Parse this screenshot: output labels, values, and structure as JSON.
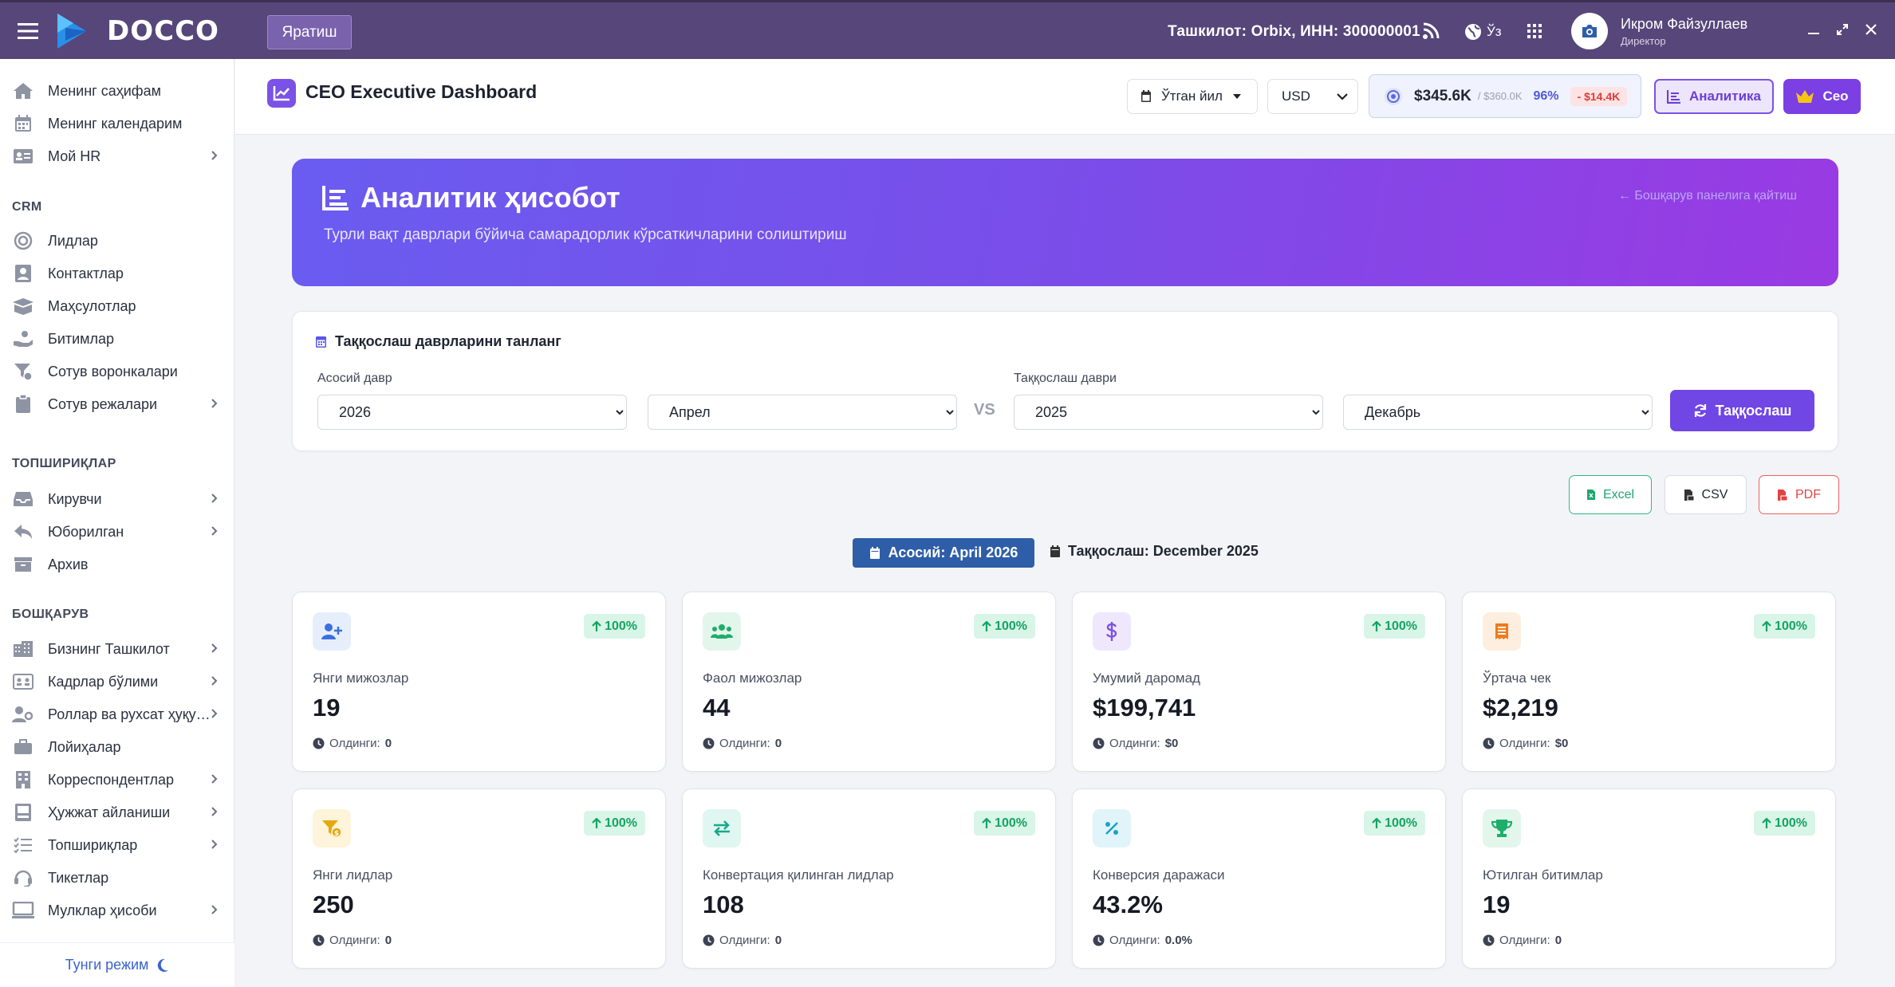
{
  "app": {
    "brand": "DOCCO",
    "create_label": "Яратиш"
  },
  "topbar": {
    "org": "Ташкилот: Orbix,  ИНН: 300000001",
    "lang": "Ўз",
    "user_name": "Икром Файзуллаев",
    "user_role": "Директор"
  },
  "sidebar": {
    "top_items": [
      {
        "label": "Менинг саҳифам",
        "icon": "home-icon"
      },
      {
        "label": "Менинг календарим",
        "icon": "calendar-icon"
      },
      {
        "label": "Мой HR",
        "icon": "id-card-icon"
      }
    ],
    "crm_title": "CRM",
    "crm_items": [
      {
        "label": "Лидлар",
        "icon": "target-icon"
      },
      {
        "label": "Контактлар",
        "icon": "contact-icon"
      },
      {
        "label": "Маҳсулотлар",
        "icon": "boxes-icon"
      },
      {
        "label": "Битимлар",
        "icon": "hand-coin-icon"
      },
      {
        "label": "Сотув воронкалари",
        "icon": "funnel-icon"
      },
      {
        "label": "Сотув режалари",
        "icon": "clipboard-icon"
      }
    ],
    "tasks_title": "ТОПШИРИҚЛАР",
    "tasks_items": [
      {
        "label": "Кирувчи",
        "icon": "inbox-icon"
      },
      {
        "label": "Юборилган",
        "icon": "reply-icon"
      },
      {
        "label": "Архив",
        "icon": "archive-icon"
      }
    ],
    "manage_title": "БОШҚАРУВ",
    "manage_items": [
      {
        "label": "Бизнинг Ташкилот",
        "icon": "building-icon"
      },
      {
        "label": "Кадрлар бўлими",
        "icon": "staff-icon"
      },
      {
        "label": "Роллар ва рухсат ҳуқу…",
        "icon": "user-key-icon"
      },
      {
        "label": "Лойиҳалар",
        "icon": "briefcase-icon"
      },
      {
        "label": "Корреспондентлар",
        "icon": "office-icon"
      },
      {
        "label": "Ҳужжат айланиши",
        "icon": "document-flow-icon"
      },
      {
        "label": "Топшириқлар",
        "icon": "task-list-icon"
      },
      {
        "label": "Тикетлар",
        "icon": "headset-icon"
      },
      {
        "label": "Мулклар ҳисоби",
        "icon": "monitor-icon"
      }
    ],
    "night_mode": "Тунги режим"
  },
  "header": {
    "title": "CEO Executive Dashboard",
    "period": "Ўтган йил",
    "currency": "USD",
    "kpi": {
      "amount": "$345.6K",
      "target": "/ $360.0K",
      "percent": "96%",
      "diff": "- $14.4K"
    },
    "analytics_label": "Аналитика",
    "ceo_label": "Ceo"
  },
  "hero": {
    "title": "Аналитик ҳисобот",
    "subtitle": "Турли вақт даврлари бўйича самарадорлик кўрсаткичларини солиштириш",
    "back_link": "← Бошқарув панелига қайтиш"
  },
  "compare": {
    "title": "Таққослаш даврларини танланг",
    "base_label": "Асосий давр",
    "cmp_label": "Таққослаш даври",
    "base_year": "2026",
    "base_month": "Апрел",
    "cmp_year": "2025",
    "cmp_month": "Декабрь",
    "vs": "VS",
    "button": "Таққослаш"
  },
  "exports": {
    "excel": "Excel",
    "csv": "CSV",
    "pdf": "PDF"
  },
  "periods": {
    "base": "Асосий: April 2026",
    "comparison": "Таққослаш: December 2025"
  },
  "cards": [
    {
      "label": "Янги мижозлар",
      "value": "19",
      "trend": "100%",
      "prev_label": "Олдинги:",
      "prev": "0",
      "icon": "user-plus-icon",
      "color": "#3b6fe0",
      "bg": "#e6eefc"
    },
    {
      "label": "Фаол мижозлар",
      "value": "44",
      "trend": "100%",
      "prev_label": "Олдинги:",
      "prev": "0",
      "icon": "users-icon",
      "color": "#1fae6a",
      "bg": "#e3f6ec"
    },
    {
      "label": "Умумий даромад",
      "value": "$199,741",
      "trend": "100%",
      "prev_label": "Олдинги:",
      "prev": "$0",
      "icon": "dollar-icon",
      "color": "#7b52e6",
      "bg": "#efe8fc"
    },
    {
      "label": "Ўртача чек",
      "value": "$2,219",
      "trend": "100%",
      "prev_label": "Олдинги:",
      "prev": "$0",
      "icon": "receipt-icon",
      "color": "#f07a1c",
      "bg": "#fdeee0"
    },
    {
      "label": "Янги лидлар",
      "value": "250",
      "trend": "100%",
      "prev_label": "Олдинги:",
      "prev": "0",
      "icon": "funnel-dollar-icon",
      "color": "#e3a90e",
      "bg": "#fdf4d9"
    },
    {
      "label": "Конвертация қилинган лидлар",
      "value": "108",
      "trend": "100%",
      "prev_label": "Олдинги:",
      "prev": "0",
      "icon": "exchange-icon",
      "color": "#17a98a",
      "bg": "#e0f6f0"
    },
    {
      "label": "Конверсия даражаси",
      "value": "43.2%",
      "trend": "100%",
      "prev_label": "Олдинги:",
      "prev": "0.0%",
      "icon": "percent-icon",
      "color": "#1aa3c4",
      "bg": "#e0f4f9"
    },
    {
      "label": "Ютилган битимлар",
      "value": "19",
      "trend": "100%",
      "prev_label": "Олдинги:",
      "prev": "0",
      "icon": "trophy-icon",
      "color": "#1fae6a",
      "bg": "#e3f6ec"
    }
  ]
}
